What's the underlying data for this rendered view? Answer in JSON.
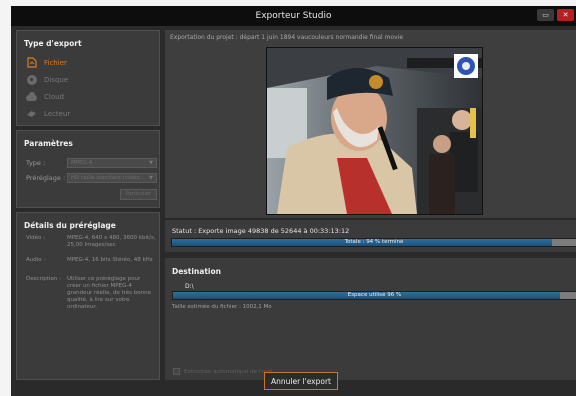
{
  "window": {
    "title": "Exporteur Studio",
    "minimize_icon": "minimize-icon",
    "close_icon": "close-icon"
  },
  "export_type": {
    "heading": "Type d'export",
    "items": [
      {
        "label": "Fichier",
        "icon": "file-icon",
        "active": true
      },
      {
        "label": "Disque",
        "icon": "disc-icon",
        "active": false
      },
      {
        "label": "Cloud",
        "icon": "cloud-icon",
        "active": false
      },
      {
        "label": "Lecteur",
        "icon": "device-icon",
        "active": false
      }
    ]
  },
  "parameters": {
    "heading": "Paramètres",
    "type_label": "Type :",
    "type_value": "MPEG-4",
    "preset_label": "Préréglage :",
    "preset_value": "HD taille standard (vidéo...",
    "custom_button": "Particulier"
  },
  "preset_details": {
    "heading": "Détails du préréglage",
    "rows": [
      {
        "label": "Vidéo :",
        "value": "MPEG-4, 640 x 480, 3600 kbit/s, 25,00 Images/sec"
      },
      {
        "label": "Audio :",
        "value": "MPEG-4, 16 bits Stéréo, 48 kHz"
      },
      {
        "label": "Description :",
        "value": "Utiliser ce préréglage pour créer un fichier MPEG-4 grandeur réelle, de très bonne qualité, à lire sur votre ordinateur."
      }
    ]
  },
  "preview": {
    "project_line": "Exportation du projet : départ 1 juin 1894 vaucouleurs normandie final movie"
  },
  "status": {
    "text": "Statut : Exporte image 49838 de 52644 à 00:33:13:12",
    "progress_label": "Totale : 94 % terminé",
    "progress_fraction": 0.94
  },
  "destination": {
    "heading": "Destination",
    "path": "D:\\",
    "space_label": "Espace utilisé 96 %",
    "space_fraction": 0.96,
    "estimated_size": "Taille estimée du fichier : 1002,1 Mo",
    "auto_shutdown": "Extinction automatique de l'ordi"
  },
  "actions": {
    "cancel_button": "Annuler l'export"
  },
  "colors": {
    "accent": "#e07a1e",
    "progress": "#2f6f9d",
    "window_bg": "#2a2a2a"
  }
}
